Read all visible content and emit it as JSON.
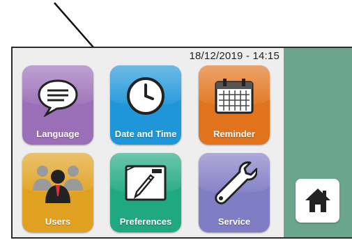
{
  "header": {
    "datetime": "18/12/2019 - 14:15"
  },
  "tiles": [
    {
      "label": "Language",
      "color": "#9b6fb8",
      "icon": "speech-bubble-icon"
    },
    {
      "label": "Date and Time",
      "color": "#1f96d8",
      "icon": "clock-icon"
    },
    {
      "label": "Reminder",
      "color": "#e1731d",
      "icon": "calendar-icon"
    },
    {
      "label": "Users",
      "color": "#e0a120",
      "icon": "users-icon"
    },
    {
      "label": "Preferences",
      "color": "#1fa882",
      "icon": "pencil-document-icon"
    },
    {
      "label": "Service",
      "color": "#7f7dc4",
      "icon": "wrench-icon"
    }
  ],
  "side_panel": {
    "color": "#6ba58b",
    "home_icon": "home-icon"
  },
  "annotation": {
    "pointer": "arrow-pointing-to-date-and-time"
  }
}
